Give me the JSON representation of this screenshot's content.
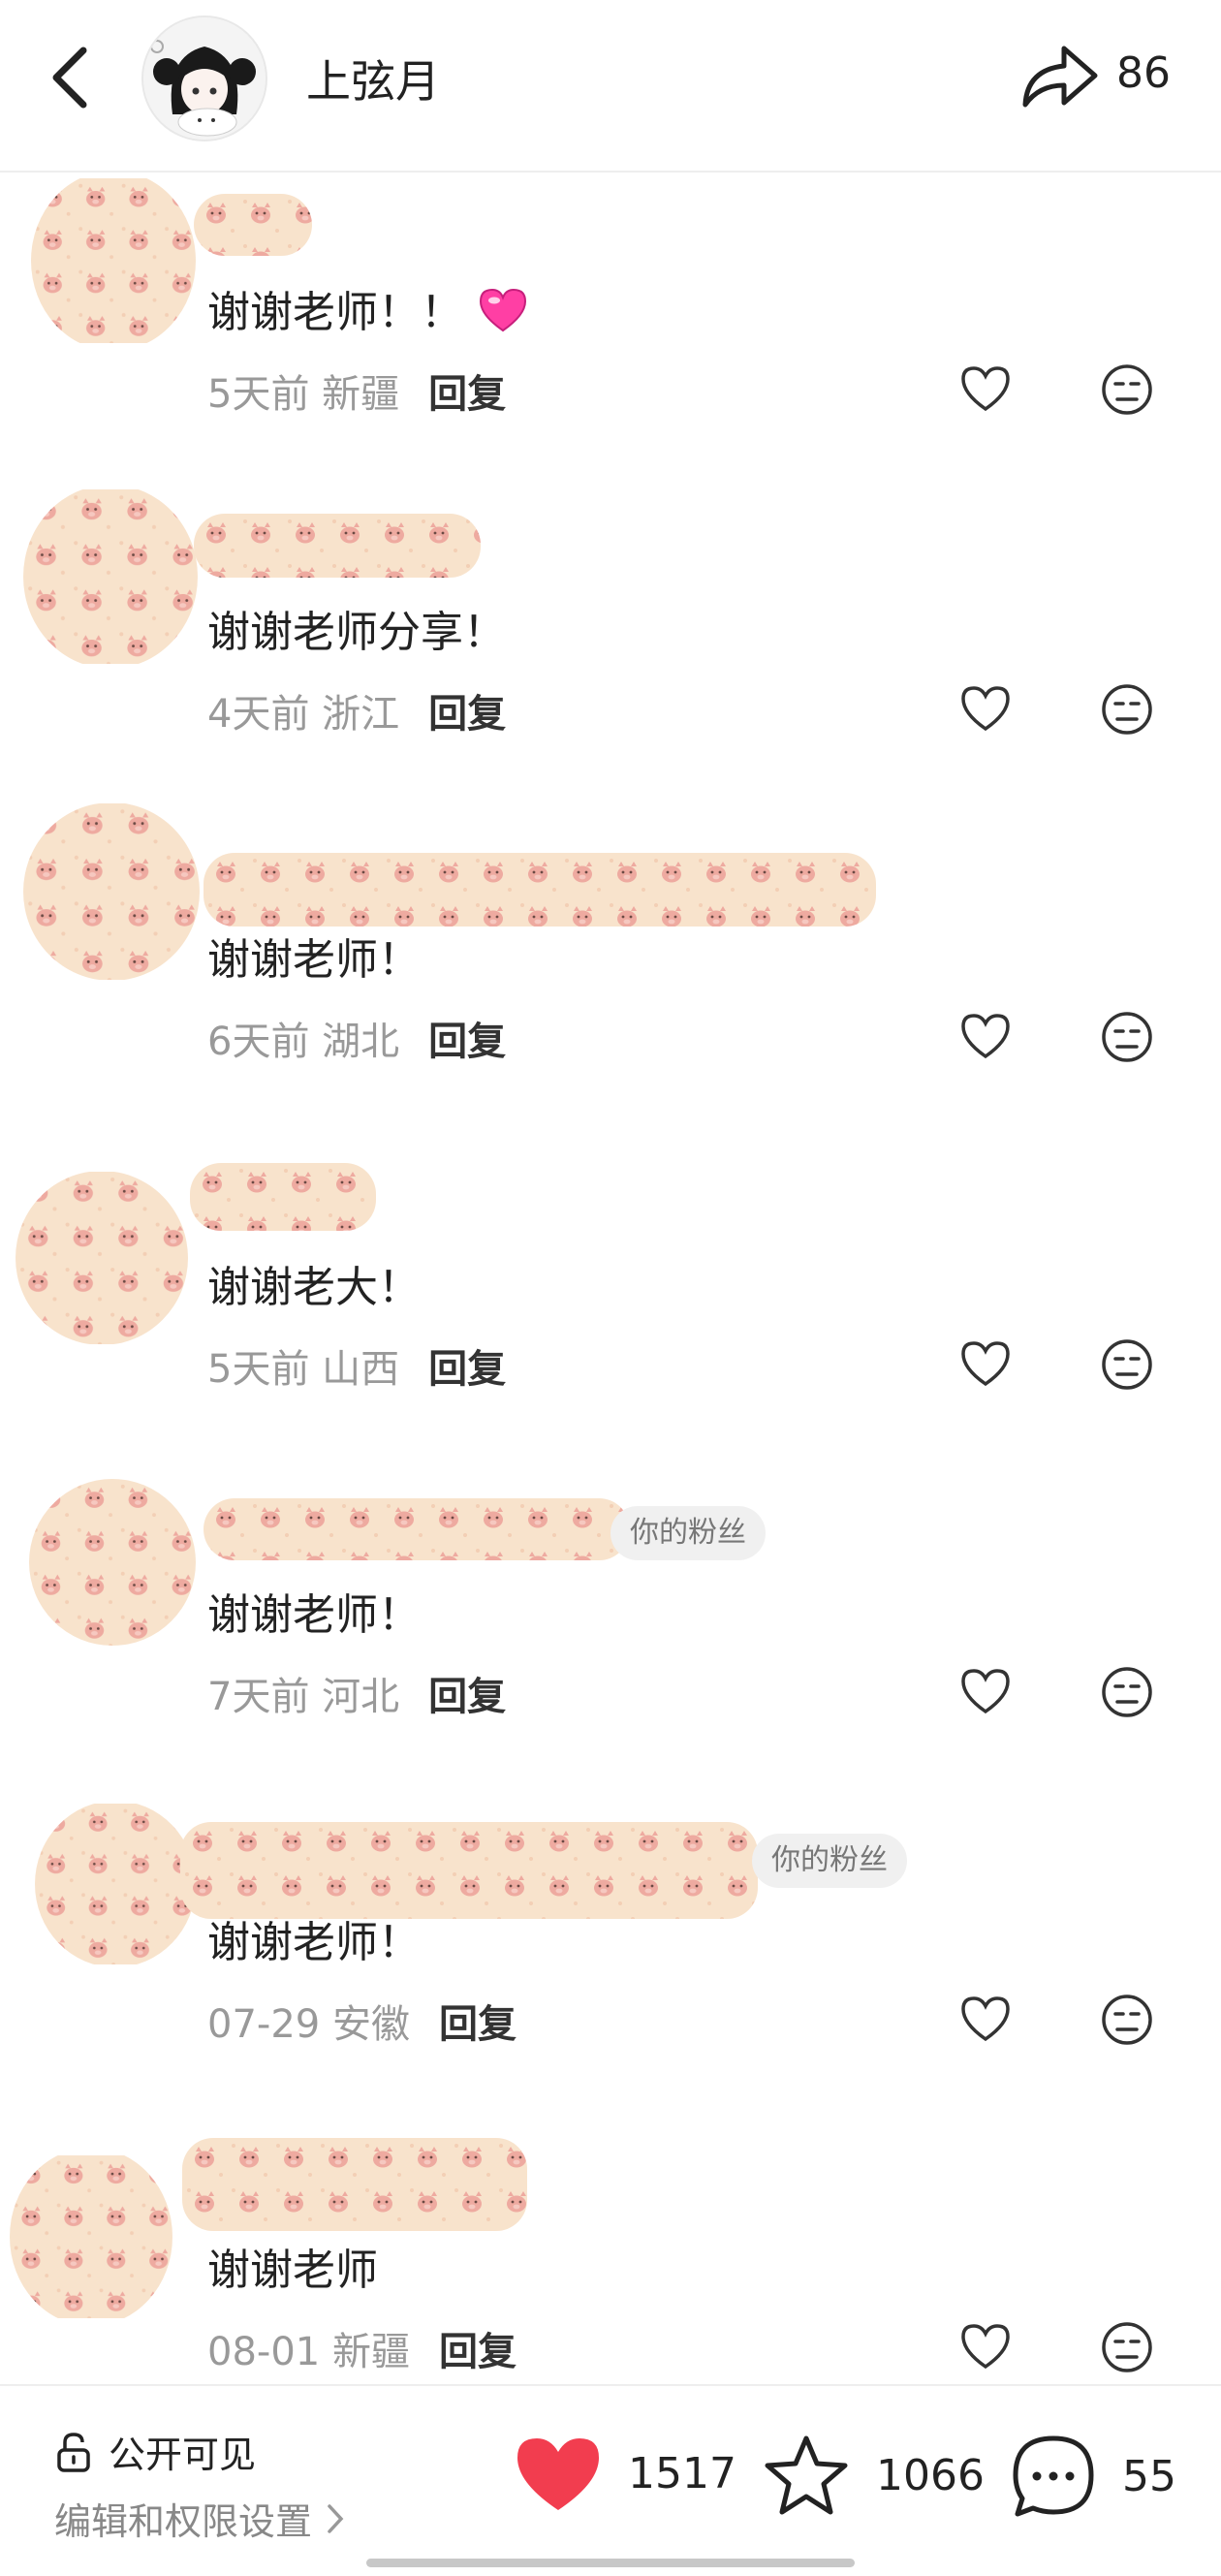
{
  "header": {
    "title": "上弦月",
    "share_count": "86"
  },
  "comments": [
    {
      "text": "谢谢老师！！",
      "date": "5天前",
      "location": "新疆",
      "reply": "回复",
      "has_emoji": true
    },
    {
      "text": "谢谢老师分享！",
      "date": "4天前",
      "location": "浙江",
      "reply": "回复"
    },
    {
      "text": "谢谢老师！",
      "date": "6天前",
      "location": "湖北",
      "reply": "回复"
    },
    {
      "text": "谢谢老大！",
      "date": "5天前",
      "location": "山西",
      "reply": "回复"
    },
    {
      "text": "谢谢老师！",
      "date": "7天前",
      "location": "河北",
      "reply": "回复",
      "badge": "你的粉丝"
    },
    {
      "text": "谢谢老师！",
      "date": "07-29",
      "location": "安徽",
      "reply": "回复",
      "badge": "你的粉丝"
    },
    {
      "text": "谢谢老师",
      "date": "08-01",
      "location": "新疆",
      "reply": "回复"
    }
  ],
  "bottom": {
    "privacy": "公开可见",
    "settings": "编辑和权限设置",
    "likes": "1517",
    "favorites": "1066",
    "comments": "55"
  },
  "colors": {
    "like_red": "#f23d4f",
    "emoji_pink": "#ff3fa4",
    "text_dark": "#222222",
    "text_grey": "#999999",
    "mosaic_base": "#f8e3cc",
    "mosaic_pig": "#eeaaa0"
  },
  "icons": {
    "back": "chevron-left-icon",
    "share": "share-arrow-icon",
    "like": "heart-outline-icon",
    "dislike": "meh-face-icon",
    "lock": "lock-icon",
    "like_filled": "heart-filled-icon",
    "favorite": "star-outline-icon",
    "comment": "chat-bubble-icon"
  }
}
